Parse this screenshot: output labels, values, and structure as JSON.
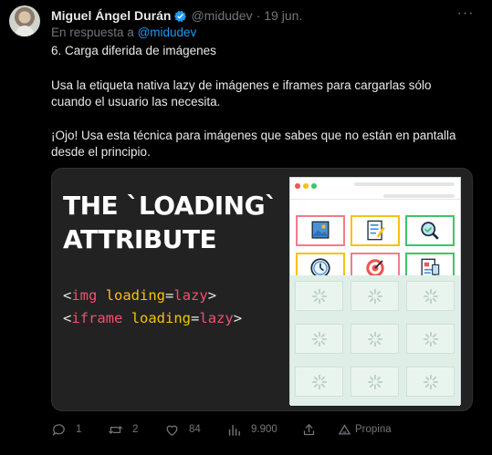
{
  "tweet": {
    "author_name": "Miguel Ángel Durán",
    "author_handle": "@midudev",
    "separator": "·",
    "date": "19 jun.",
    "reply_prefix": "En respuesta a",
    "reply_mention": "@midudev",
    "paragraphs": [
      "6. Carga diferida de imágenes",
      "Usa la etiqueta nativa lazy de imágenes e iframes para cargarlas sólo cuando el usuario las necesita.",
      "¡Ojo! Usa esta técnica para imágenes que sabes que no están en pantalla desde el principio."
    ]
  },
  "media": {
    "title_line1": "THE `LOADING`",
    "title_line2": "ATTRIBUTE",
    "code_line1": {
      "lt": "<",
      "tag": "img",
      "attr": "loading",
      "eq": "=",
      "val": "lazy",
      "gt": ">"
    },
    "code_line2": {
      "lt": "<",
      "tag": "iframe",
      "attr": "loading",
      "eq": "=",
      "val": "lazy",
      "gt": ">"
    },
    "tile_icons": [
      "image-icon",
      "checklist-icon",
      "magnifier-icon",
      "clock-icon",
      "target-icon",
      "document-chart-icon"
    ],
    "placeholder_icon": "loading-spinner-icon"
  },
  "actions": {
    "reply_count": "1",
    "retweet_count": "2",
    "like_count": "84",
    "view_count": "9.900",
    "promote_label": "Propina"
  },
  "colors": {
    "accent": "#1d9bf0",
    "muted": "#71767b",
    "code_tag": "#f0506e",
    "code_attr": "#f5c211"
  }
}
